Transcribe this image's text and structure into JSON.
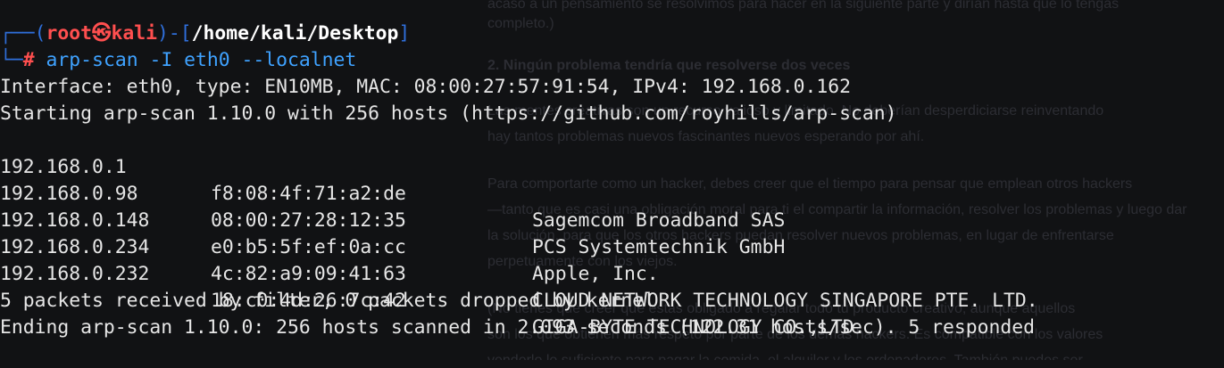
{
  "prompt": {
    "corner_top": "┌──(",
    "user": "root",
    "at_symbol": "㉿",
    "host": "kali",
    "mid": ")-[",
    "path": "/home/kali/Desktop",
    "end": "]",
    "corner_bottom": "└─",
    "hash": "#",
    "command": "arp-scan -I eth0 --localnet"
  },
  "output": {
    "interface_line": "Interface: eth0, type: EN10MB, MAC: 08:00:27:57:91:54, IPv4: 192.168.0.162",
    "starting_line": "Starting arp-scan 1.10.0 with 256 hosts (https://github.com/royhills/arp-scan)",
    "hosts": [
      {
        "ip": "192.168.0.1",
        "mac": "f8:08:4f:71:a2:de",
        "vendor": "Sagemcom Broadband SAS"
      },
      {
        "ip": "192.168.0.98",
        "mac": "08:00:27:28:12:35",
        "vendor": "PCS Systemtechnik GmbH"
      },
      {
        "ip": "192.168.0.148",
        "mac": "e0:b5:5f:ef:0a:cc",
        "vendor": "Apple, Inc."
      },
      {
        "ip": "192.168.0.234",
        "mac": "4c:82:a9:09:41:63",
        "vendor": "CLOUD NETWORK TECHNOLOGY SINGAPORE PTE. LTD."
      },
      {
        "ip": "192.168.0.232",
        "mac": "18:c0:4d:26:7c:42",
        "vendor": "GIGA-BYTE TECHNOLOGY CO.,LTD."
      }
    ],
    "packets_line": "5 packets received by filter, 0 packets dropped by kernel",
    "ending_line": "Ending arp-scan 1.10.0: 256 hosts scanned in 2.093 seconds (122.31 hosts/sec). 5 responded"
  },
  "background_page": {
    "lines": [
      "acaso a un pensamiento se resolvimos para hacer en la siguiente parte y dirían hasta que lo tengas",
      "completo.)",
      "2. Ningún problema tendría que resolverse dos veces",
      "Las mentes creativas son un recurso valioso y limitado. No deberían desperdiciarse reinventando",
      "hay tantos problemas nuevos fascinantes nuevos esperando por ahí.",
      "Para comportarte como un hacker, debes creer que el tiempo para pensar que emplean otros hackers",
      "—tanto que es casi una obligación moral para ti el compartir la información, resolver los problemas y luego dar",
      "la solución, para que los otros hackers puedan resolver nuevos problemas, en lugar de enfrentarse",
      "perpetuamente con los viejos.",
      "(No tienes que creer que estás obligado a regalar todo tu producto creativo, aunque aquellos",
      "son los que obtienen más respeto por parte de los demás hackers. Es compatible con los valores",
      "venderlo lo suficiente para pagar la comida, el alquiler y los ordenadores. También puedes ser"
    ]
  }
}
